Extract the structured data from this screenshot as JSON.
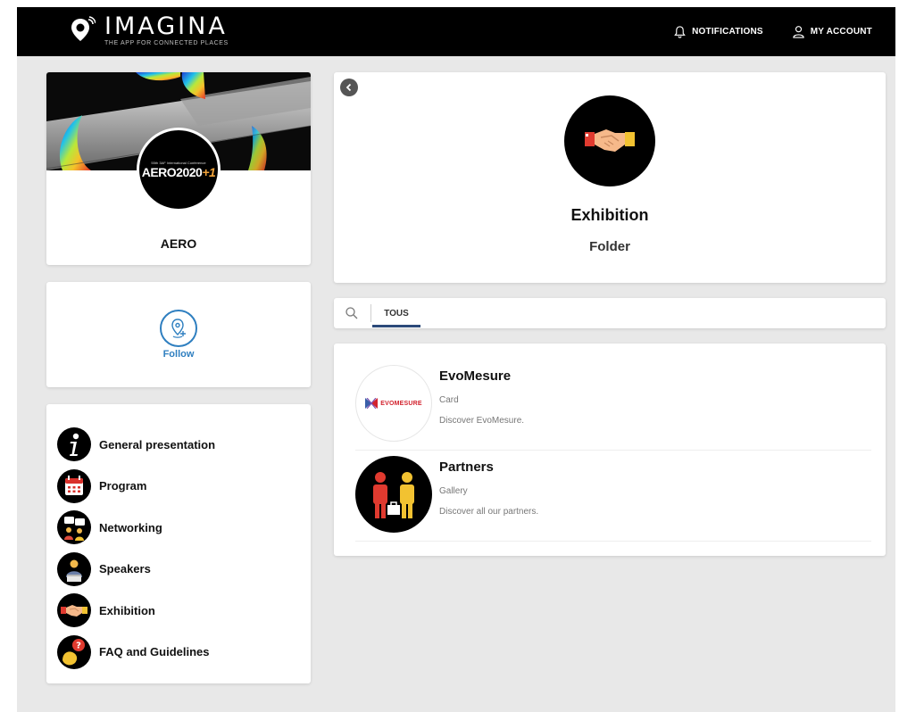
{
  "header": {
    "brand_name": "IMAGINA",
    "brand_tagline": "THE APP FOR CONNECTED PLACES",
    "notifications_label": "NOTIFICATIONS",
    "account_label": "MY ACCOUNT"
  },
  "profile": {
    "name": "AERO",
    "logo_text_small": "55th 3AF International Conference",
    "logo_text_main": "AERO2020",
    "logo_text_suffix": "+1"
  },
  "follow": {
    "label": "Follow"
  },
  "menu": {
    "items": [
      {
        "label": "General presentation",
        "icon": "info-icon"
      },
      {
        "label": "Program",
        "icon": "calendar-icon"
      },
      {
        "label": "Networking",
        "icon": "networking-icon"
      },
      {
        "label": "Speakers",
        "icon": "speaker-icon"
      },
      {
        "label": "Exhibition",
        "icon": "handshake-icon"
      },
      {
        "label": "FAQ and Guidelines",
        "icon": "faq-icon"
      }
    ]
  },
  "folder": {
    "title": "Exhibition",
    "subtitle": "Folder"
  },
  "tabs": {
    "active": "TOUS"
  },
  "items": [
    {
      "title": "EvoMesure",
      "type": "Card",
      "description": "Discover EvoMesure.",
      "logo_text": "EVOMESURE"
    },
    {
      "title": "Partners",
      "type": "Gallery",
      "description": "Discover all our partners."
    }
  ],
  "colors": {
    "topbar": "#000000",
    "background": "#e8e8e8",
    "accent_blue": "#2f7fc0",
    "tab_underline": "#2c4a7a",
    "evo_red": "#d2222d"
  }
}
